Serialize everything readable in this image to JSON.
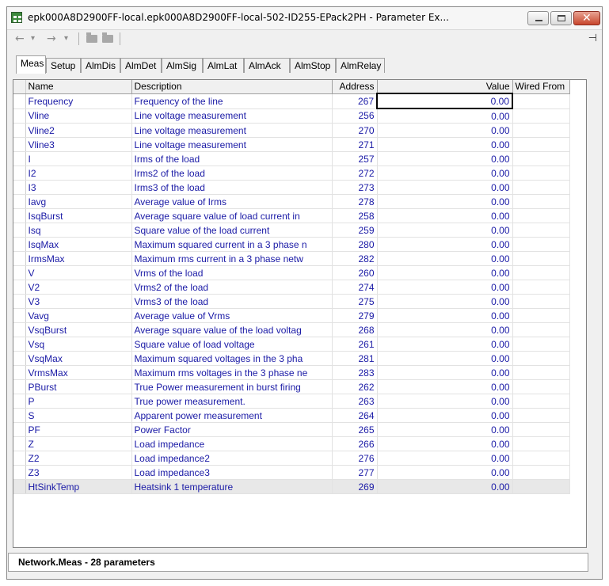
{
  "window": {
    "title": "epk000A8D2900FF-local.epk000A8D2900FF-local-502-ID255-EPack2PH - Parameter Ex...",
    "close_glyph": "✕"
  },
  "toolbar": {
    "back_icon": "←",
    "back_drop": "▾",
    "forward_icon": "→",
    "forward_drop": "▾",
    "pin_icon": "⊣"
  },
  "tabs": [
    "Meas",
    "Setup",
    "AlmDis",
    "AlmDet",
    "AlmSig",
    "AlmLat",
    "AlmAck",
    "AlmStop",
    "AlmRelay"
  ],
  "grid": {
    "columns": {
      "name": "Name",
      "description": "Description",
      "address": "Address",
      "value": "Value",
      "wired_from": "Wired From"
    },
    "rows": [
      {
        "name": "Frequency",
        "description": "Frequency of the line",
        "address": "267",
        "value": "0.00"
      },
      {
        "name": "Vline",
        "description": "Line voltage measurement",
        "address": "256",
        "value": "0.00"
      },
      {
        "name": "Vline2",
        "description": "Line voltage measurement",
        "address": "270",
        "value": "0.00"
      },
      {
        "name": "Vline3",
        "description": "Line voltage measurement",
        "address": "271",
        "value": "0.00"
      },
      {
        "name": "I",
        "description": "Irms of the load",
        "address": "257",
        "value": "0.00"
      },
      {
        "name": "I2",
        "description": "Irms2 of the load",
        "address": "272",
        "value": "0.00"
      },
      {
        "name": "I3",
        "description": "Irms3 of the load",
        "address": "273",
        "value": "0.00"
      },
      {
        "name": "Iavg",
        "description": "Average value of Irms",
        "address": "278",
        "value": "0.00"
      },
      {
        "name": "IsqBurst",
        "description": "Average square value of load current in",
        "address": "258",
        "value": "0.00"
      },
      {
        "name": "Isq",
        "description": "Square value of the load current",
        "address": "259",
        "value": "0.00"
      },
      {
        "name": "IsqMax",
        "description": "Maximum squared current in a 3 phase n",
        "address": "280",
        "value": "0.00"
      },
      {
        "name": "IrmsMax",
        "description": "Maximum rms current in a 3 phase netw",
        "address": "282",
        "value": "0.00"
      },
      {
        "name": "V",
        "description": "Vrms of the load",
        "address": "260",
        "value": "0.00"
      },
      {
        "name": "V2",
        "description": "Vrms2 of the load",
        "address": "274",
        "value": "0.00"
      },
      {
        "name": "V3",
        "description": "Vrms3 of the load",
        "address": "275",
        "value": "0.00"
      },
      {
        "name": "Vavg",
        "description": "Average value of Vrms",
        "address": "279",
        "value": "0.00"
      },
      {
        "name": "VsqBurst",
        "description": "Average square value of the load voltag",
        "address": "268",
        "value": "0.00"
      },
      {
        "name": "Vsq",
        "description": "Square value of load voltage",
        "address": "261",
        "value": "0.00"
      },
      {
        "name": "VsqMax",
        "description": "Maximum squared voltages in the 3 pha",
        "address": "281",
        "value": "0.00"
      },
      {
        "name": "VrmsMax",
        "description": "Maximum rms voltages in the 3 phase ne",
        "address": "283",
        "value": "0.00"
      },
      {
        "name": "PBurst",
        "description": "True Power measurement in burst firing",
        "address": "262",
        "value": "0.00"
      },
      {
        "name": "P",
        "description": "True power measurement.",
        "address": "263",
        "value": "0.00"
      },
      {
        "name": "S",
        "description": "Apparent power measurement",
        "address": "264",
        "value": "0.00"
      },
      {
        "name": "PF",
        "description": "Power Factor",
        "address": "265",
        "value": "0.00"
      },
      {
        "name": "Z",
        "description": "Load impedance",
        "address": "266",
        "value": "0.00"
      },
      {
        "name": "Z2",
        "description": "Load impedance2",
        "address": "276",
        "value": "0.00"
      },
      {
        "name": "Z3",
        "description": "Load impedance3",
        "address": "277",
        "value": "0.00"
      },
      {
        "name": "HtSinkTemp",
        "description": "Heatsink 1 temperature",
        "address": "269",
        "value": "0.00"
      }
    ]
  },
  "status": {
    "text": "Network.Meas  -  28 parameters"
  }
}
